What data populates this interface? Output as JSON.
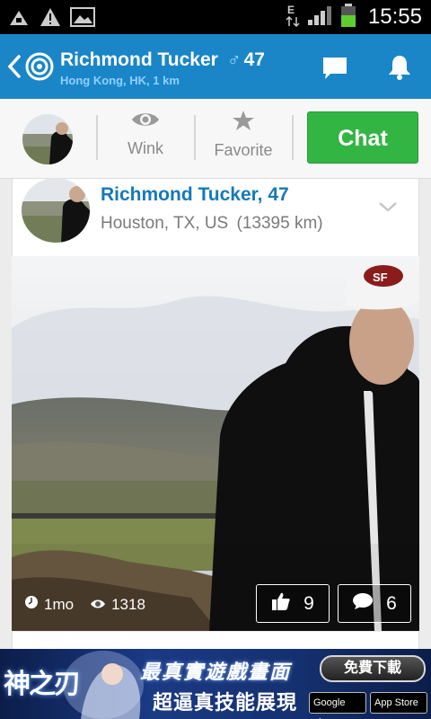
{
  "status_bar": {
    "time": "15:55"
  },
  "header": {
    "name": "Richmond Tucker",
    "gender_symbol": "♂",
    "age": "47",
    "location": "Hong Kong, HK, 1 km"
  },
  "actions": {
    "wink_label": "Wink",
    "favorite_label": "Favorite",
    "chat_label": "Chat"
  },
  "post": {
    "title": "Richmond Tucker, 47",
    "location": "Houston, TX, US",
    "distance": "(13395 km)",
    "age_text": "1mo",
    "views": "1318",
    "likes": "9",
    "comments": "6"
  },
  "ad": {
    "brand": "神之刃",
    "line1": "最真實遊戲畫面",
    "line2": "超逼真技能展現",
    "download_label": "免費下載",
    "store1": "Google play",
    "store2": "App Store"
  },
  "colors": {
    "header_bg": "#1a86c8",
    "chat_green": "#33b544",
    "name_blue": "#1679b9"
  }
}
